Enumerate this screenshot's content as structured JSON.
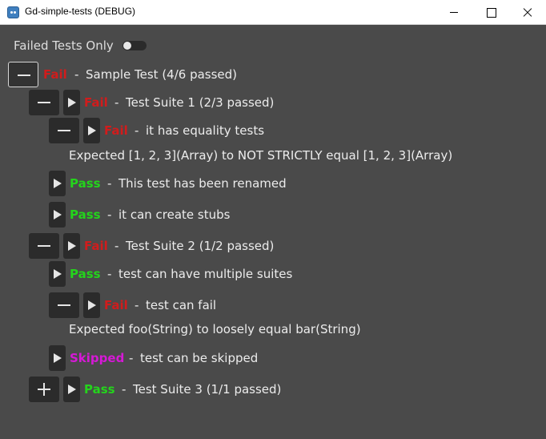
{
  "window": {
    "title": "Gd-simple-tests (DEBUG)"
  },
  "filter": {
    "label": "Failed Tests Only",
    "enabled": false
  },
  "colors": {
    "fail": "#d11c1c",
    "pass": "#24d41c",
    "skipped": "#d619d6",
    "background": "#4a4a4a",
    "button": "#2b2b2b"
  },
  "separator": "-",
  "tree": {
    "root": {
      "status": "Fail",
      "label": "Sample Test (4/6 passed)",
      "expand_icon": "minus-icon"
    },
    "suite1": {
      "status": "Fail",
      "label": "Test Suite 1 (2/3 passed)",
      "expand_icon": "minus-icon"
    },
    "suite1_test1": {
      "status": "Fail",
      "label": "it has equality tests",
      "expand_icon": "minus-icon",
      "message": "Expected [1, 2, 3](Array) to NOT STRICTLY equal [1, 2, 3](Array)"
    },
    "suite1_test2": {
      "status": "Pass",
      "label": "This test has been renamed"
    },
    "suite1_test3": {
      "status": "Pass",
      "label": "it can create stubs"
    },
    "suite2": {
      "status": "Fail",
      "label": "Test Suite 2 (1/2 passed)",
      "expand_icon": "minus-icon"
    },
    "suite2_test1": {
      "status": "Pass",
      "label": "test can have multiple suites"
    },
    "suite2_test2": {
      "status": "Fail",
      "label": "test can fail",
      "expand_icon": "minus-icon",
      "message": "Expected foo(String) to loosely equal bar(String)"
    },
    "suite2_test3": {
      "status": "Skipped",
      "label": "test can be skipped"
    },
    "suite3": {
      "status": "Pass",
      "label": "Test Suite 3 (1/1 passed)",
      "expand_icon": "plus-icon"
    }
  }
}
